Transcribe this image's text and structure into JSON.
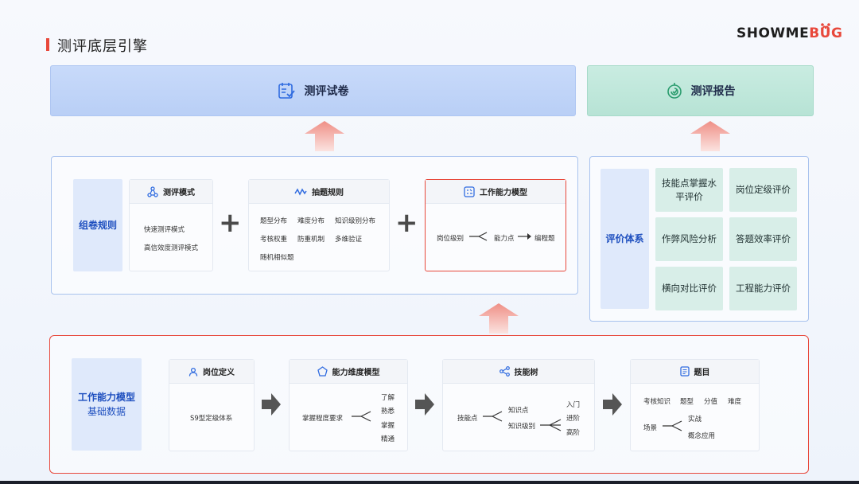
{
  "header": {
    "title": "测评底层引擎",
    "brand_main": "SHOWME",
    "brand_accent": "BUG",
    "accent_color": "#e8483b"
  },
  "top": {
    "paper": "测评试卷",
    "report": "测评报告"
  },
  "compose": {
    "label": "组卷规则",
    "mode": {
      "title": "测评模式",
      "items": [
        "快速测评模式",
        "高信效度测评模式"
      ]
    },
    "rules": {
      "title": "抽题规则",
      "items": [
        "题型分布",
        "难度分布",
        "知识级别分布",
        "考核权重",
        "防重机制",
        "多维验证",
        "随机相似题"
      ]
    },
    "model": {
      "title": "工作能力模型",
      "level": "岗位级别",
      "point": "能力点",
      "question": "编程题"
    }
  },
  "evaluation": {
    "label": "评价体系",
    "items": [
      "技能点掌握水平评价",
      "岗位定级评价",
      "作弊风险分析",
      "答题效率评价",
      "横向对比评价",
      "工程能力评价"
    ]
  },
  "base": {
    "label_line1": "工作能力模型",
    "label_line2": "基础数据",
    "post": {
      "title": "岗位定义",
      "item": "S9型定级体系"
    },
    "dimension": {
      "title": "能力维度模型",
      "root": "掌握程度要求",
      "leaves": [
        "了解",
        "熟悉",
        "掌握",
        "精通"
      ]
    },
    "skilltree": {
      "title": "技能树",
      "root": "技能点",
      "mid": [
        "知识点",
        "知识级别"
      ],
      "leaves": [
        "入门",
        "进阶",
        "高阶"
      ]
    },
    "question": {
      "title": "题目",
      "row1": [
        "考核知识",
        "题型",
        "分值",
        "难度"
      ],
      "root": "场景",
      "leaves": [
        "实战",
        "概念应用"
      ]
    }
  }
}
